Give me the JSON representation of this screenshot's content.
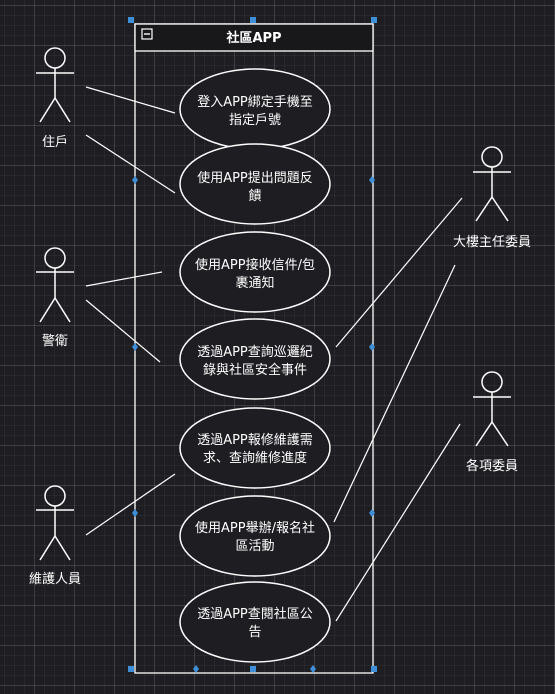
{
  "system": {
    "title": "社區APP"
  },
  "actors": [
    {
      "id": "resident",
      "label": "住戶"
    },
    {
      "id": "guard",
      "label": "警衛"
    },
    {
      "id": "maintenance",
      "label": "維護人員"
    },
    {
      "id": "chair",
      "label": "大樓主任委員"
    },
    {
      "id": "member",
      "label": "各項委員"
    }
  ],
  "use_cases": [
    {
      "id": "uc1",
      "lines": [
        "登入APP綁定手機至",
        "指定戶號"
      ]
    },
    {
      "id": "uc2",
      "lines": [
        "使用APP提出問題反",
        "饋"
      ]
    },
    {
      "id": "uc3",
      "lines": [
        "使用APP接收信件/包",
        "裹通知"
      ]
    },
    {
      "id": "uc4",
      "lines": [
        "透過APP查詢巡邏紀",
        "錄與社區安全事件"
      ]
    },
    {
      "id": "uc5",
      "lines": [
        "透過APP報修維護需",
        "求、查詢維修進度"
      ]
    },
    {
      "id": "uc6",
      "lines": [
        "使用APP舉辦/報名社",
        "區活動"
      ]
    },
    {
      "id": "uc7",
      "lines": [
        "透過APP查閱社區公",
        "告"
      ]
    }
  ],
  "associations": [
    [
      "resident",
      "uc1"
    ],
    [
      "resident",
      "uc2"
    ],
    [
      "guard",
      "uc3"
    ],
    [
      "guard",
      "uc4"
    ],
    [
      "maintenance",
      "uc5"
    ],
    [
      "chair",
      "uc4"
    ],
    [
      "chair",
      "uc6"
    ],
    [
      "member",
      "uc7"
    ]
  ]
}
